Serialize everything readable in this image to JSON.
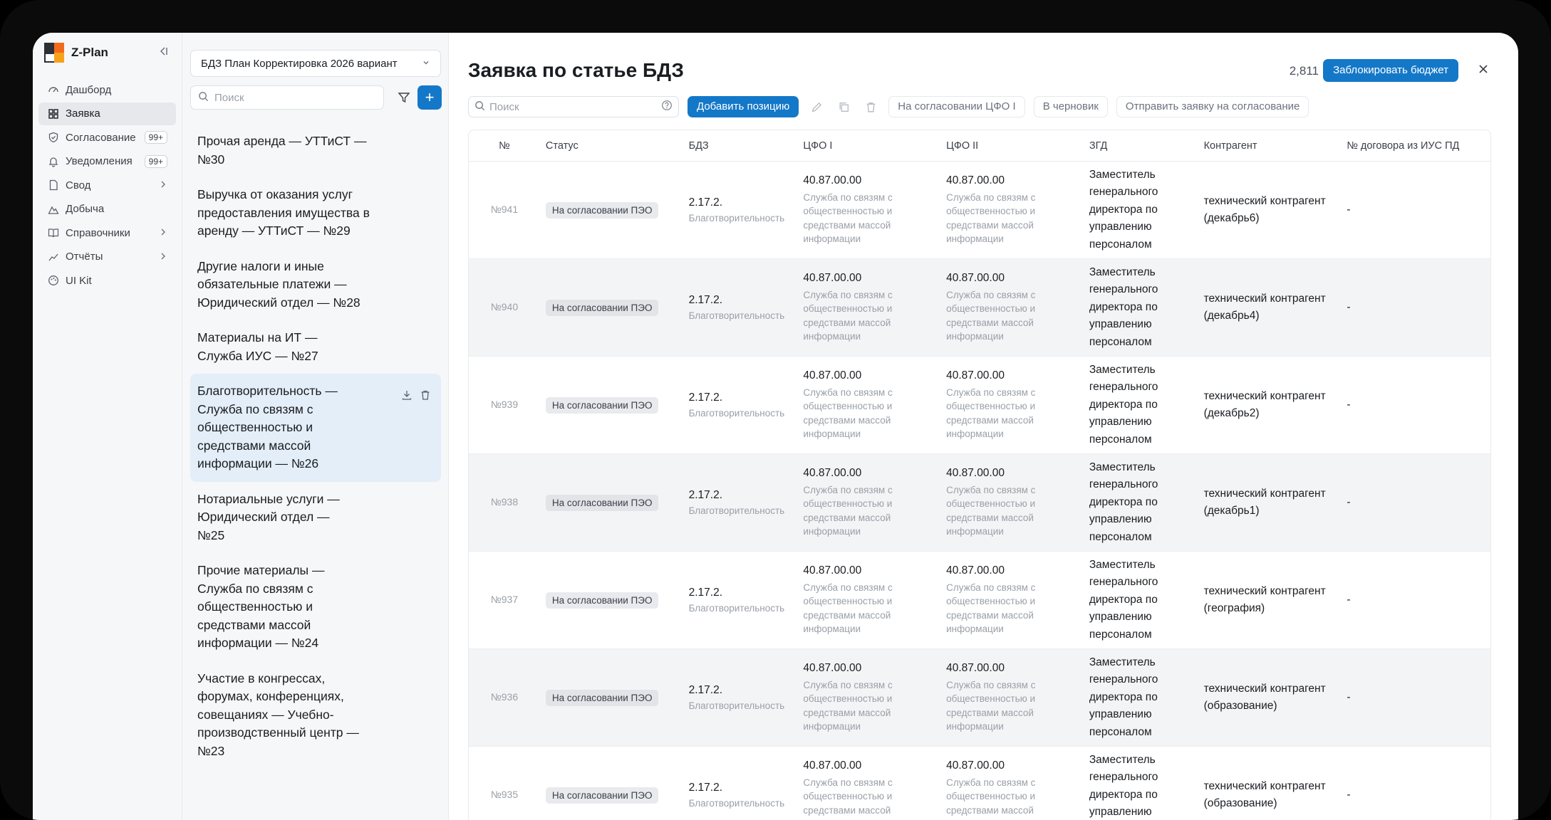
{
  "app": {
    "name": "Z-Plan"
  },
  "sidebar": {
    "items": [
      {
        "label": "Дашборд",
        "icon": "dashboard-icon"
      },
      {
        "label": "Заявка",
        "icon": "grid-icon",
        "active": true
      },
      {
        "label": "Согласование",
        "icon": "shield-check-icon",
        "badge": "99+"
      },
      {
        "label": "Уведомления",
        "icon": "bell-icon",
        "badge": "99+"
      },
      {
        "label": "Свод",
        "icon": "file-icon",
        "chevron": true
      },
      {
        "label": "Добыча",
        "icon": "mountain-icon"
      },
      {
        "label": "Справочники",
        "icon": "book-icon",
        "chevron": true
      },
      {
        "label": "Отчёты",
        "icon": "chart-icon",
        "chevron": true
      },
      {
        "label": "UI Kit",
        "icon": "palette-icon"
      }
    ]
  },
  "middle": {
    "select_value": "БДЗ План Корректировка 2026 вариант",
    "search_placeholder": "Поиск",
    "items": [
      "Прочая аренда — УТТиСТ — №30",
      "Выручка от оказания услуг предоставления имущества в аренду — УТТиСТ — №29",
      "Другие налоги и иные обязательные платежи — Юридический отдел — №28",
      "Материалы на ИТ — Служба ИУС — №27",
      "Благотворительность — Служба по связям с общественностью и средствами массой информации — №26",
      "Нотариальные услуги — Юридический отдел — №25",
      "Прочие материалы — Служба по связям с общественностью и средствами массой информации — №24",
      "Участие в конгрессах, форумах, конференциях, совещаниях — Учебно-производственный центр — №23"
    ]
  },
  "main": {
    "title": "Заявка по статье БДЗ",
    "count": "2,811",
    "lock_label": "Заблокировать бюджет",
    "search_placeholder": "Поиск",
    "add_label": "Добавить позицию",
    "btn_cfo": "На согласовании ЦФО I",
    "btn_draft": "В черновик",
    "btn_send": "Отправить заявку на согласование"
  },
  "table": {
    "headers": [
      "№",
      "Статус",
      "БДЗ",
      "ЦФО I",
      "ЦФО II",
      "ЗГД",
      "Контрагент",
      "№ договора из ИУС ПД"
    ],
    "rows": [
      {
        "num": "№941",
        "status": "На согласовании ПЭО",
        "bdz": "2.17.2.",
        "bdz_sub": "Благотворительность",
        "cfo1": "40.87.00.00",
        "cfo1_sub": "Служба по связям с общественностью и средствами массой информации",
        "cfo2": "40.87.00.00",
        "cfo2_sub": "Служба по связям с общественностью и средствами массой информации",
        "zgd": "Заместитель генерального директора по управлению персоналом",
        "kontr": "технический контрагент (декабрь6)",
        "dog": "-"
      },
      {
        "num": "№940",
        "status": "На согласовании ПЭО",
        "bdz": "2.17.2.",
        "bdz_sub": "Благотворительность",
        "cfo1": "40.87.00.00",
        "cfo1_sub": "Служба по связям с общественностью и средствами массой информации",
        "cfo2": "40.87.00.00",
        "cfo2_sub": "Служба по связям с общественностью и средствами массой информации",
        "zgd": "Заместитель генерального директора по управлению персоналом",
        "kontr": "технический контрагент (декабрь4)",
        "dog": "-"
      },
      {
        "num": "№939",
        "status": "На согласовании ПЭО",
        "bdz": "2.17.2.",
        "bdz_sub": "Благотворительность",
        "cfo1": "40.87.00.00",
        "cfo1_sub": "Служба по связям с общественностью и средствами массой информации",
        "cfo2": "40.87.00.00",
        "cfo2_sub": "Служба по связям с общественностью и средствами массой информации",
        "zgd": "Заместитель генерального директора по управлению персоналом",
        "kontr": "технический контрагент (декабрь2)",
        "dog": "-"
      },
      {
        "num": "№938",
        "status": "На согласовании ПЭО",
        "bdz": "2.17.2.",
        "bdz_sub": "Благотворительность",
        "cfo1": "40.87.00.00",
        "cfo1_sub": "Служба по связям с общественностью и средствами массой информации",
        "cfo2": "40.87.00.00",
        "cfo2_sub": "Служба по связям с общественностью и средствами массой информации",
        "zgd": "Заместитель генерального директора по управлению персоналом",
        "kontr": "технический контрагент (декабрь1)",
        "dog": "-"
      },
      {
        "num": "№937",
        "status": "На согласовании ПЭО",
        "bdz": "2.17.2.",
        "bdz_sub": "Благотворительность",
        "cfo1": "40.87.00.00",
        "cfo1_sub": "Служба по связям с общественностью и средствами массой информации",
        "cfo2": "40.87.00.00",
        "cfo2_sub": "Служба по связям с общественностью и средствами массой информации",
        "zgd": "Заместитель генерального директора по управлению персоналом",
        "kontr": "технический контрагент (география)",
        "dog": "-"
      },
      {
        "num": "№936",
        "status": "На согласовании ПЭО",
        "bdz": "2.17.2.",
        "bdz_sub": "Благотворительность",
        "cfo1": "40.87.00.00",
        "cfo1_sub": "Служба по связям с общественностью и средствами массой информации",
        "cfo2": "40.87.00.00",
        "cfo2_sub": "Служба по связям с общественностью и средствами массой информации",
        "zgd": "Заместитель генерального директора по управлению персоналом",
        "kontr": "технический контрагент (образование)",
        "dog": "-"
      },
      {
        "num": "№935",
        "status": "На согласовании ПЭО",
        "bdz": "2.17.2.",
        "bdz_sub": "Благотворительность",
        "cfo1": "40.87.00.00",
        "cfo1_sub": "Служба по связям с общественностью и средствами массой информации",
        "cfo2": "40.87.00.00",
        "cfo2_sub": "Служба по связям с общественностью и средствами массой информации",
        "zgd": "Заместитель генерального директора по управлению персоналом",
        "kontr": "технический контрагент (образование)",
        "dog": "-"
      }
    ]
  },
  "colors": {
    "accent": "#1478c8",
    "selected": "#e4eef8",
    "logo_orange": "#f26b1d",
    "logo_yellow": "#f6a21d"
  }
}
